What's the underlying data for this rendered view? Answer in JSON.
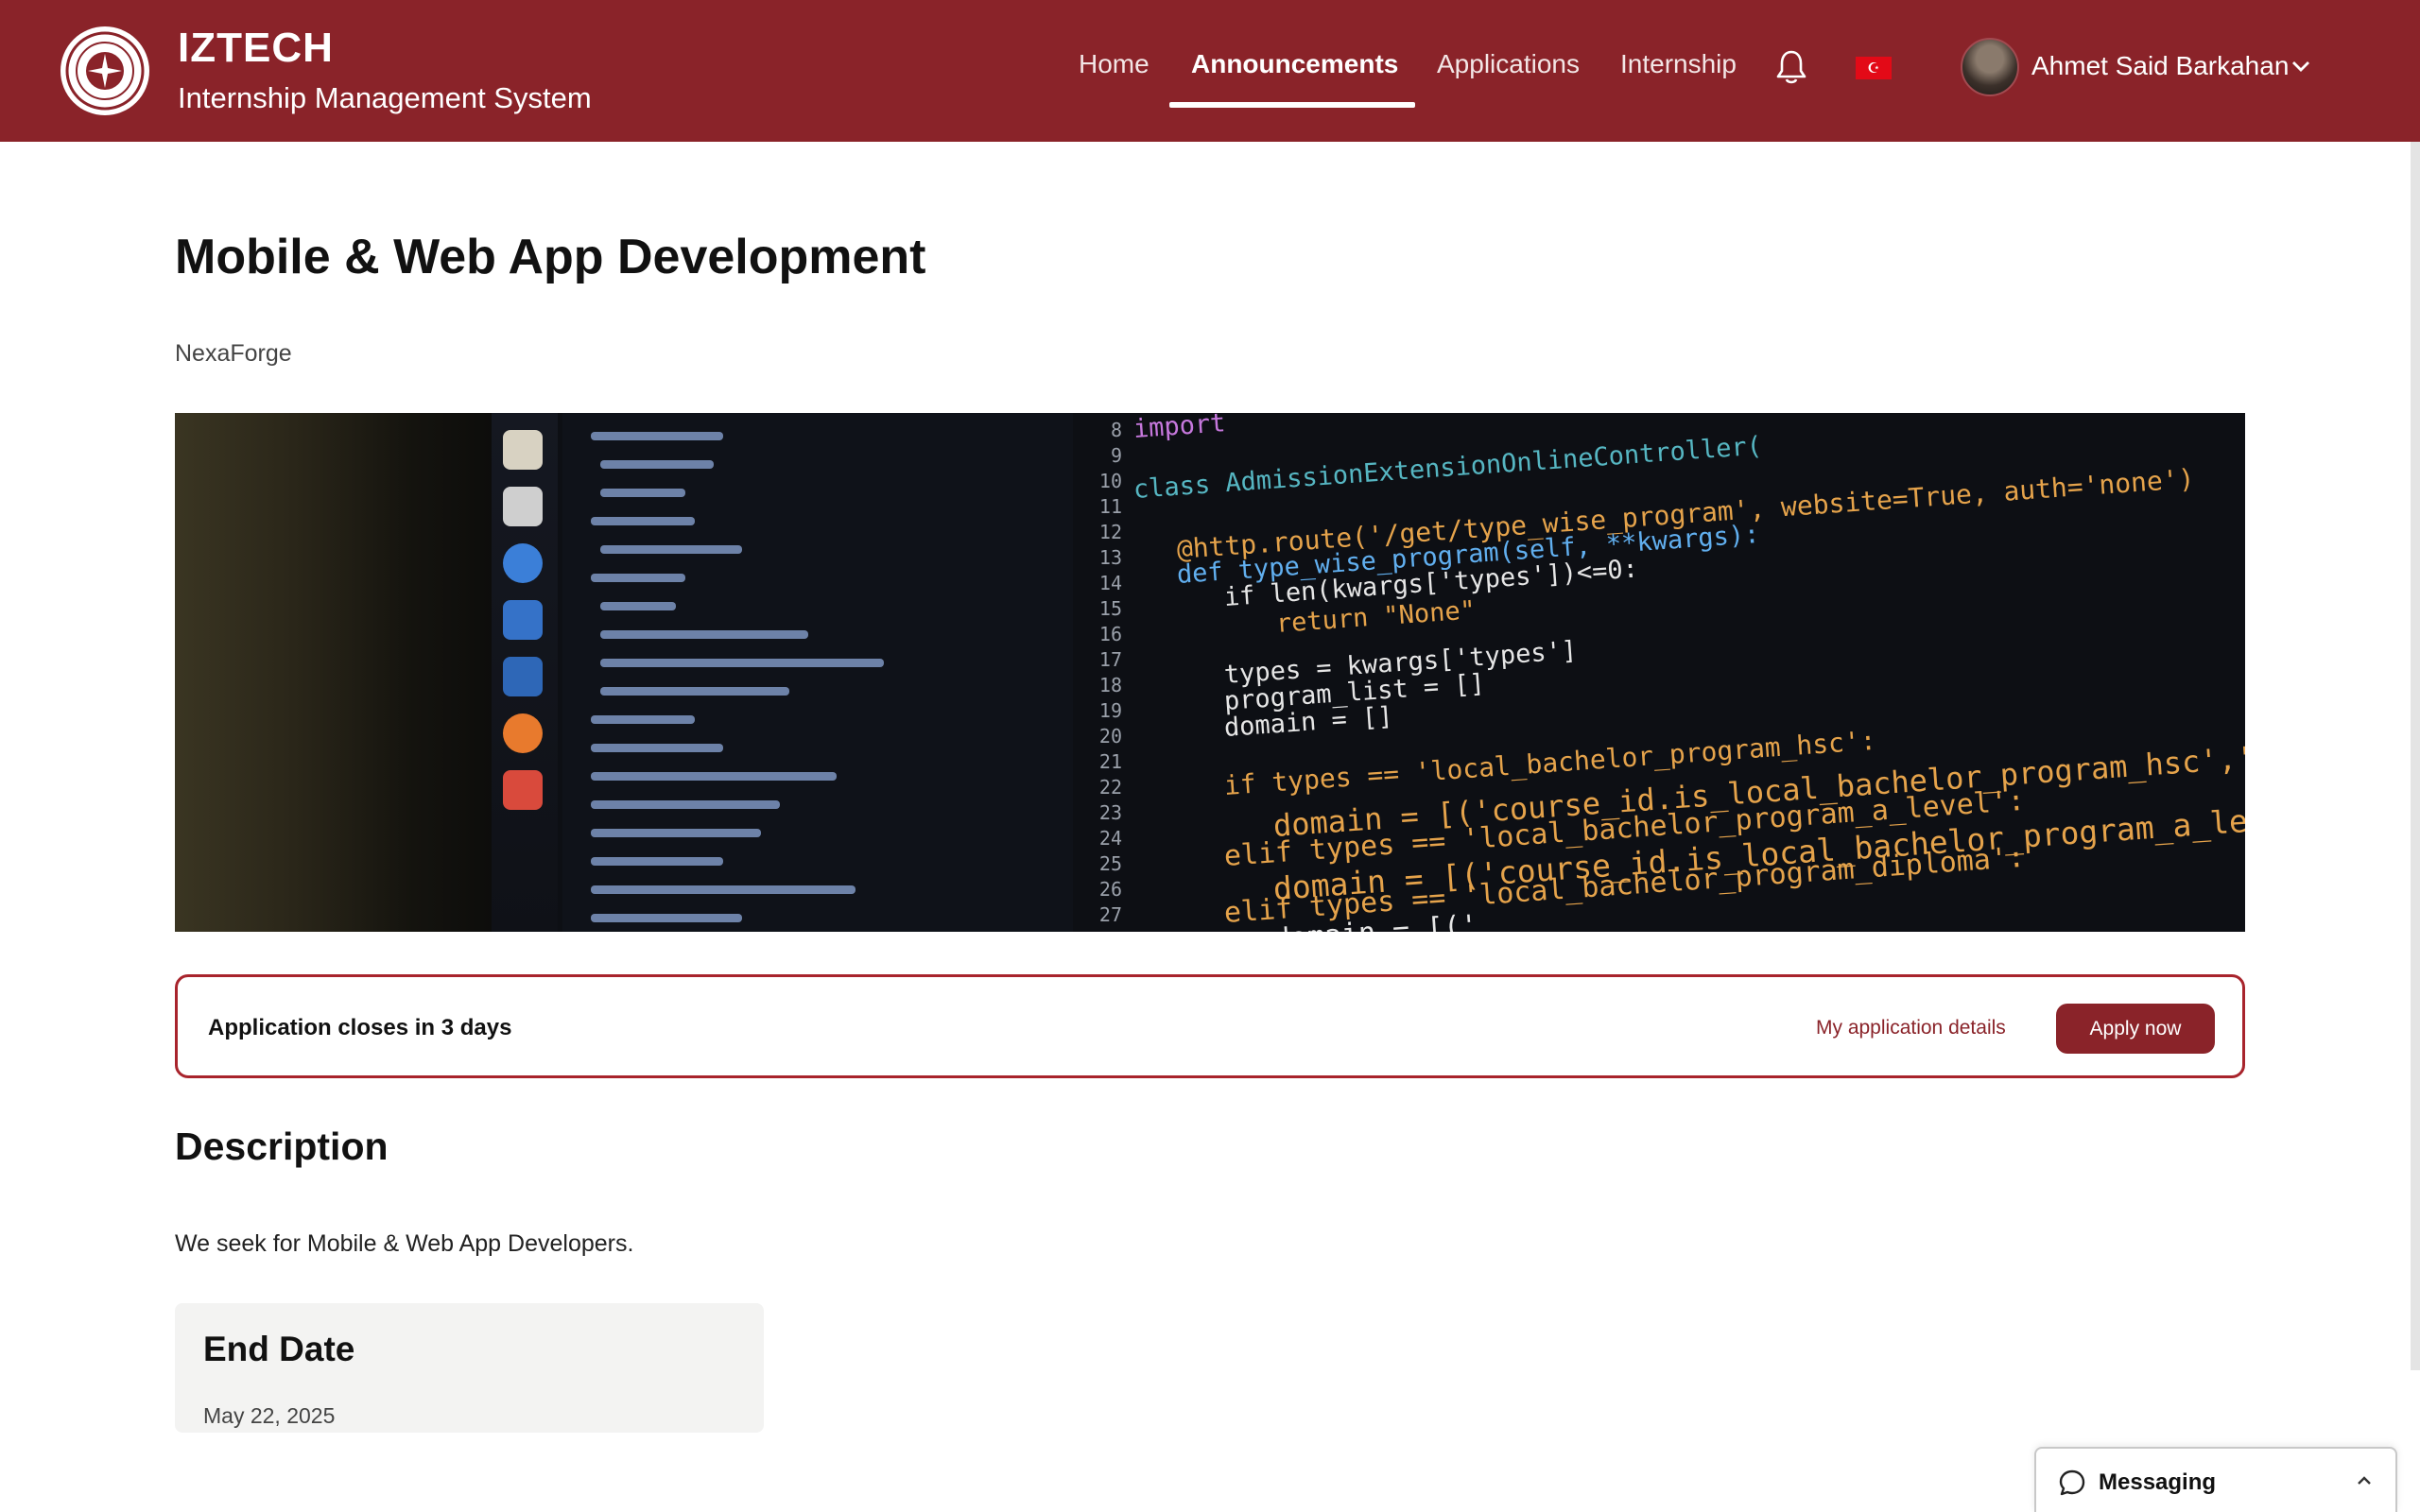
{
  "header": {
    "brand_title": "IZTECH",
    "brand_subtitle": "Internship Management System",
    "nav": [
      {
        "label": "Home",
        "active": false
      },
      {
        "label": "Announcements",
        "active": true
      },
      {
        "label": "Applications",
        "active": false
      },
      {
        "label": "Internship",
        "active": false
      }
    ],
    "icons": {
      "logo": "iztech-seal-icon",
      "notifications": "bell-icon",
      "language": "turkish-flag-icon",
      "user_menu": "chevron-down-icon"
    },
    "flag_glyph": "☪",
    "user_name": "Ahmet Said Barkahan",
    "colors": {
      "brand": "#8a2329",
      "text_on_brand": "#ffffff"
    }
  },
  "announcement": {
    "title": "Mobile & Web App Development",
    "company": "NexaForge",
    "hero_image": {
      "line_numbers": [
        "8",
        "9",
        "10",
        "11",
        "12",
        "13",
        "14",
        "15",
        "16",
        "17",
        "18",
        "19",
        "20",
        "21",
        "22",
        "23",
        "24",
        "25",
        "26",
        "27"
      ],
      "code_lines": [
        "import",
        "class AdmissionExtensionOnlineController(",
        "@http.route('/get/type_wise_program', website=True, auth='none')",
        "def type_wise_program(self, **kwargs):",
        "if len(kwargs['types'])<=0:",
        "return \"None\"",
        "types = kwargs['types']",
        "program_list = []",
        "domain = []",
        "if types == 'local_bachelor_program_hsc':",
        "domain = [('course_id.is_local_bachelor_program_hsc','='",
        "elif types == 'local_bachelor_program_a_level':",
        "domain = [('course_id.is_local_bachelor_program_a_level'",
        "elif types == 'local_bachelor_program_diploma':",
        "domain = [('"
      ]
    },
    "closing_banner": {
      "text": "Application closes in 3 days",
      "details_link": "My application details",
      "apply_button": "Apply now"
    },
    "description_heading": "Description",
    "description_text": "We seek for Mobile & Web App Developers.",
    "end_date": {
      "label": "End Date",
      "value": "May 22, 2025"
    }
  },
  "messaging": {
    "label": "Messaging",
    "icon": "chat-bubble-icon",
    "toggle_icon": "chevron-up-icon"
  }
}
